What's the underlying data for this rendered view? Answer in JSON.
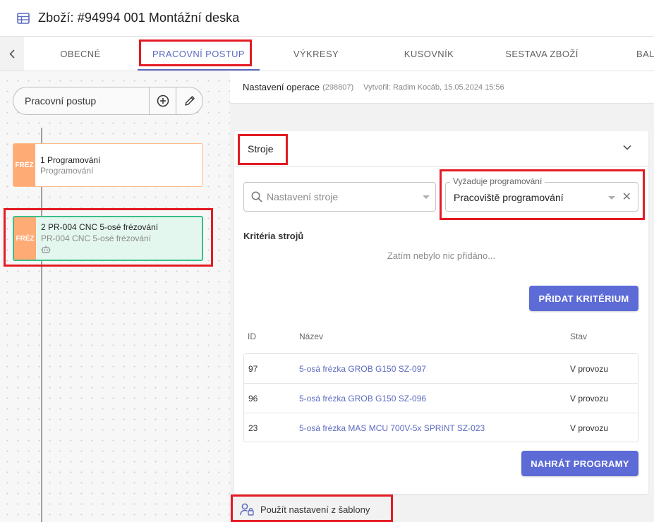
{
  "header": {
    "title": "Zboží: #94994 001 Montážní deska",
    "icon": "table-icon"
  },
  "tabs": [
    {
      "label": "OBECNÉ"
    },
    {
      "label": "PRACOVNÍ POSTUP",
      "active": true
    },
    {
      "label": "VÝKRESY"
    },
    {
      "label": "KUSOVNÍK"
    },
    {
      "label": "SESTAVA ZBOŽÍ"
    },
    {
      "label": "BAL"
    }
  ],
  "left": {
    "pill_label": "Pracovní postup",
    "operations": [
      {
        "tag": "FRÉZ",
        "line1": "1 Programování",
        "line2": "Programování"
      },
      {
        "tag": "FRÉZ",
        "line1": "2 PR-004 CNC 5-osé frézování",
        "line2": "PR-004 CNC 5-osé frézování",
        "selected": true
      }
    ]
  },
  "topbar": {
    "title": "Nastavení operace",
    "id": "(298807)",
    "created": "Vytvořil: Radim Kocáb, 15.05.2024 15:56"
  },
  "machines": {
    "title": "Stroje",
    "setting_placeholder": "Nastavení stroje",
    "programming_legend": "Vyžaduje programování",
    "programming_value": "Pracoviště programování",
    "criteria_title": "Kritéria strojů",
    "criteria_empty": "Zatím nebylo nic přidáno...",
    "add_criterion": "PŘIDAT KRITÉRIUM",
    "columns": {
      "id": "ID",
      "name": "Název",
      "state": "Stav"
    },
    "rows": [
      {
        "id": "97",
        "name": "5-osá frézka GROB G150 SZ-097",
        "state": "V provozu"
      },
      {
        "id": "96",
        "name": "5-osá frézka GROB G150 SZ-096",
        "state": "V provozu"
      },
      {
        "id": "23",
        "name": "5-osá frézka MAS MCU 700V-5x SPRINT SZ-023",
        "state": "V provozu"
      }
    ],
    "upload_programs": "NAHRÁT PROGRAMY"
  },
  "footer": {
    "label": "Použít nastavení z šablony",
    "icon": "user-lock-icon"
  },
  "colors": {
    "accent": "#5c6bc0",
    "button": "#5c6bd6",
    "tag": "#ffab75",
    "selected_bg": "#e4f7ef",
    "selected_border": "#3bbf8a",
    "highlight": "#e41b23"
  }
}
